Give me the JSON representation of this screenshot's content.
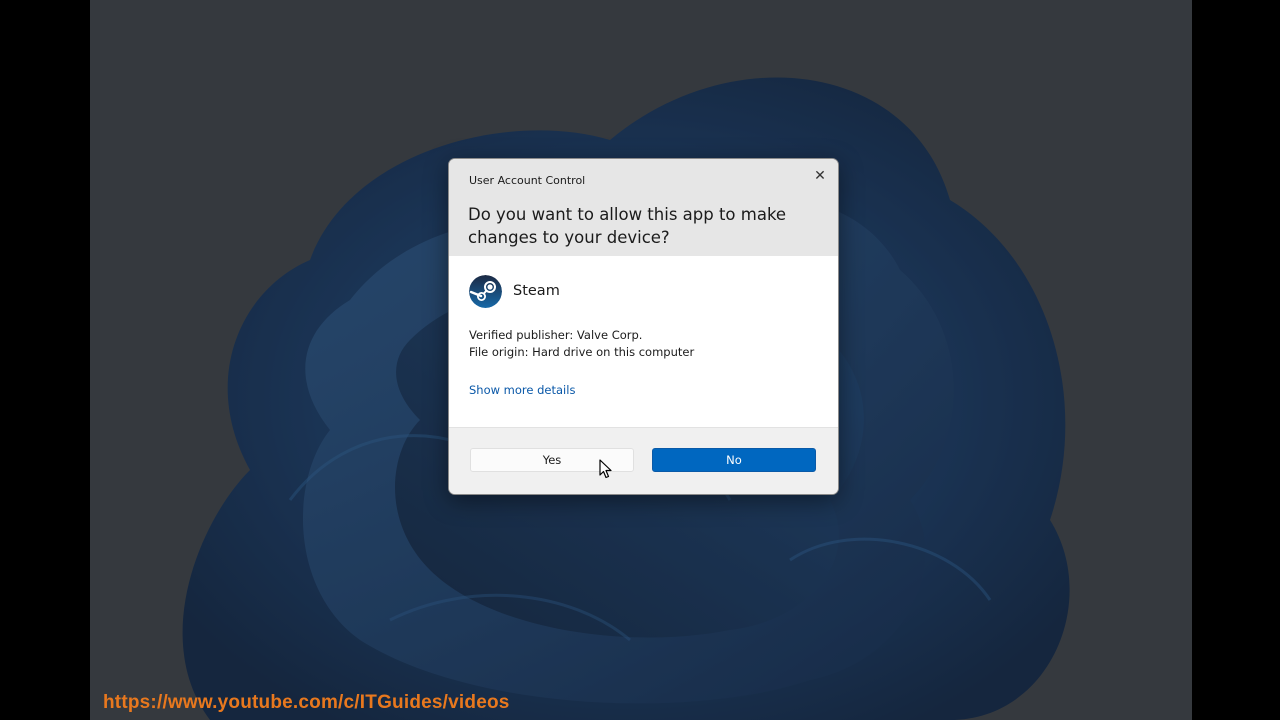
{
  "dialog": {
    "title": "User Account Control",
    "question": "Do you want to allow this app to make changes to your device?",
    "close_icon": "close-icon",
    "app": {
      "name": "Steam",
      "icon": "steam-logo-icon"
    },
    "publisher": "Verified publisher: Valve Corp.",
    "origin": "File origin: Hard drive on this computer",
    "more_details": "Show more details",
    "yes_label": "Yes",
    "no_label": "No"
  },
  "colors": {
    "accent": "#0067c0",
    "link": "#0a58a8",
    "watermark": "#e8781e"
  },
  "watermark": "https://www.youtube.com/c/ITGuides/videos"
}
